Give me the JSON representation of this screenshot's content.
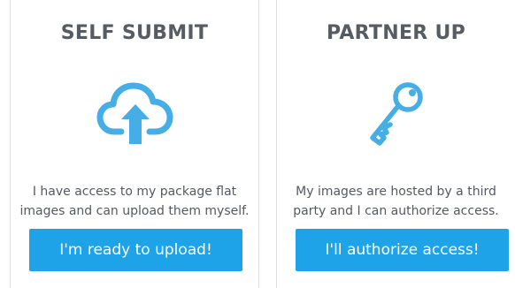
{
  "cards": [
    {
      "title": "SELF SUBMIT",
      "icon": "cloud-upload-icon",
      "description_lines": [
        "I have access to my package flat",
        "images and can upload them myself."
      ],
      "button_label": "I'm ready to upload!"
    },
    {
      "title": "PARTNER UP",
      "icon": "key-icon",
      "description_lines": [
        "My images are hosted by a third",
        "party and I can authorize access."
      ],
      "button_label": "I'll authorize access!"
    }
  ],
  "colors": {
    "accent": "#1ea2e8",
    "icon": "#46aee6",
    "title": "#555c63",
    "text": "#555a60",
    "divider": "#dedede"
  }
}
